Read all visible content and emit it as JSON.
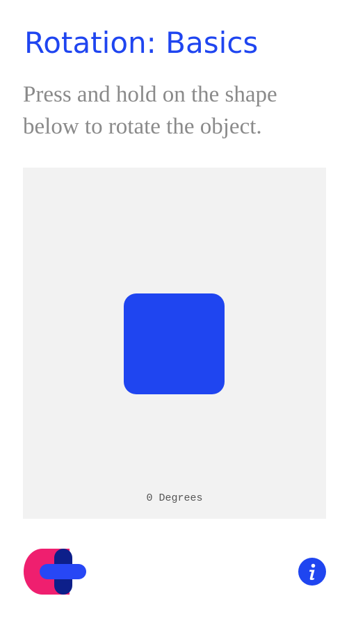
{
  "header": {
    "title": "Rotation: Basics",
    "instructions": "Press and hold on the shape below to rotate the object."
  },
  "stage": {
    "rotation_label": "0 Degrees",
    "rotation_degrees": 0
  },
  "footer": {
    "logo_icon": "brand-logo-icon",
    "info_icon": "info-icon"
  },
  "colors": {
    "accent": "#1f45f0",
    "title_text": "#1f45f0",
    "instruction_text": "#8a8a8a",
    "stage_background": "#f2f2f2",
    "shape": "#1f45f0",
    "logo_pink": "#ef1f6f",
    "logo_navy": "#0d1f8a",
    "logo_blue": "#2747f5"
  }
}
